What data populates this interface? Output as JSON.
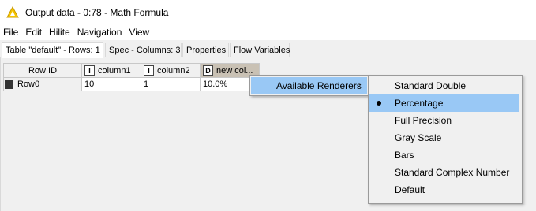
{
  "window": {
    "title": "Output data - 0:78 - Math Formula",
    "icon": "warning-triangle-icon"
  },
  "menubar": {
    "items": [
      {
        "label": "File"
      },
      {
        "label": "Edit"
      },
      {
        "label": "Hilite"
      },
      {
        "label": "Navigation"
      },
      {
        "label": "View"
      }
    ]
  },
  "tabs": [
    {
      "label": "Table \"default\" - Rows: 1",
      "active": true
    },
    {
      "label": "Spec - Columns: 3",
      "active": false
    },
    {
      "label": "Properties",
      "active": false
    },
    {
      "label": "Flow Variables",
      "active": false
    }
  ],
  "table": {
    "columns": [
      {
        "label": "Row ID",
        "type": ""
      },
      {
        "label": "column1",
        "type": "I"
      },
      {
        "label": "column2",
        "type": "I"
      },
      {
        "label": "new col...",
        "type": "D"
      }
    ],
    "rows": [
      {
        "cells": [
          "Row0",
          "10",
          "1",
          "10.0%"
        ]
      }
    ]
  },
  "context_menu": {
    "items": [
      {
        "label": "Available Renderers",
        "has_submenu": true
      }
    ]
  },
  "submenu": {
    "items": [
      {
        "label": "Standard Double",
        "selected": false
      },
      {
        "label": "Percentage",
        "selected": true
      },
      {
        "label": "Full Precision",
        "selected": false
      },
      {
        "label": "Gray Scale",
        "selected": false
      },
      {
        "label": "Bars",
        "selected": false
      },
      {
        "label": "Standard Complex Number",
        "selected": false
      },
      {
        "label": "Default",
        "selected": false
      }
    ]
  },
  "colors": {
    "highlight": "#99c8f5",
    "header_highlight": "#c9c1b4",
    "icon_yellow": "#f5c400"
  }
}
